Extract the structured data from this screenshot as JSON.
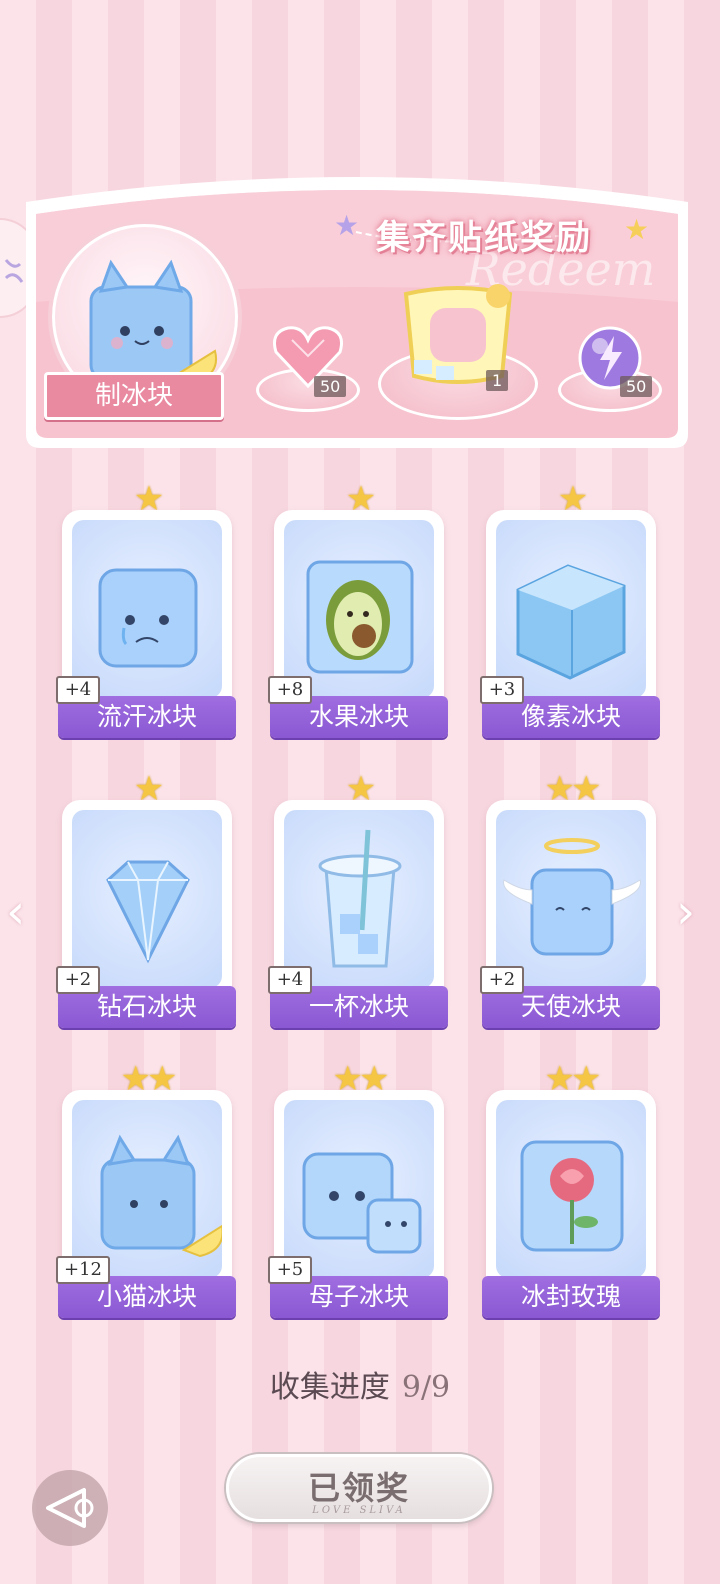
{
  "banner": {
    "title": "集齐贴纸奖励",
    "watermark": "Redeem",
    "main_item_label": "制冰块",
    "rewards": [
      {
        "icon": "heart-gem-icon",
        "count": "50"
      },
      {
        "icon": "lemonade-frame-icon",
        "count": "1"
      },
      {
        "icon": "lightning-orb-icon",
        "count": "50"
      }
    ]
  },
  "cards": [
    {
      "name": "流汗冰块",
      "count": "+4",
      "stars": 1
    },
    {
      "name": "水果冰块",
      "count": "+8",
      "stars": 1
    },
    {
      "name": "像素冰块",
      "count": "+3",
      "stars": 1
    },
    {
      "name": "钻石冰块",
      "count": "+2",
      "stars": 1
    },
    {
      "name": "一杯冰块",
      "count": "+4",
      "stars": 1
    },
    {
      "name": "天使冰块",
      "count": "+2",
      "stars": 2
    },
    {
      "name": "小猫冰块",
      "count": "+12",
      "stars": 2
    },
    {
      "name": "母子冰块",
      "count": "+5",
      "stars": 2
    },
    {
      "name": "冰封玫瑰",
      "count": "",
      "stars": 2
    }
  ],
  "progress": {
    "label": "收集进度",
    "value": "9/9"
  },
  "claim_button": {
    "label": "已领奖",
    "sub": "LOVE SLIVA"
  },
  "nav": {
    "prev": "‹",
    "next": "›"
  },
  "star_glyphs": {
    "one": "★",
    "two": "★★"
  },
  "colors": {
    "accent_pink": "#e98aa1",
    "label_purple": "#9a66dc",
    "star_gold": "#f5c544"
  }
}
